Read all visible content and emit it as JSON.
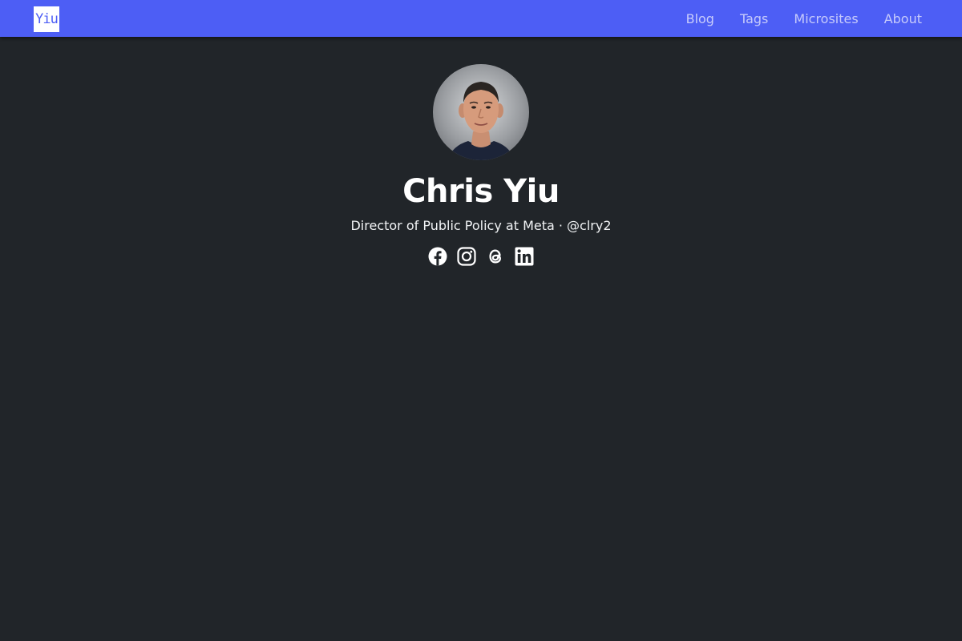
{
  "header": {
    "logo_text": "Yiu",
    "nav": [
      {
        "label": "Blog"
      },
      {
        "label": "Tags"
      },
      {
        "label": "Microsites"
      },
      {
        "label": "About"
      }
    ]
  },
  "profile": {
    "name": "Chris Yiu",
    "bio": "Director of Public Policy at Meta · @clry2",
    "avatar_icon": "profile-photo",
    "socials": [
      {
        "icon": "facebook-icon"
      },
      {
        "icon": "instagram-icon"
      },
      {
        "icon": "threads-icon"
      },
      {
        "icon": "linkedin-icon"
      }
    ]
  },
  "colors": {
    "nav_background": "#4d5ef5",
    "page_background": "#212529",
    "nav_text": "#c7cbfb",
    "text": "#ffffff"
  }
}
